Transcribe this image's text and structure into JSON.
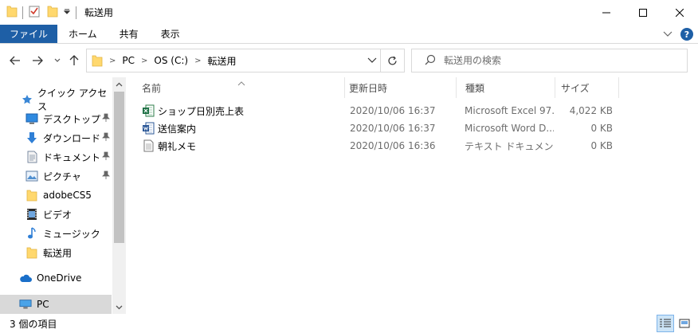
{
  "window": {
    "title": "転送用"
  },
  "ribbon": {
    "tabs": [
      {
        "label": "ファイル"
      },
      {
        "label": "ホーム"
      },
      {
        "label": "共有"
      },
      {
        "label": "表示"
      }
    ],
    "help_label": "?"
  },
  "address": {
    "crumbs": [
      "PC",
      "OS (C:)",
      "転送用"
    ]
  },
  "search": {
    "placeholder": "転送用の検索"
  },
  "nav": {
    "items": [
      {
        "label": "クイック アクセス",
        "icon": "star-icon"
      },
      {
        "label": "デスクトップ",
        "icon": "desktop-icon",
        "pinned": true
      },
      {
        "label": "ダウンロード",
        "icon": "download-icon",
        "pinned": true
      },
      {
        "label": "ドキュメント",
        "icon": "document-icon",
        "pinned": true
      },
      {
        "label": "ピクチャ",
        "icon": "picture-icon",
        "pinned": true
      },
      {
        "label": "adobeCS5",
        "icon": "folder-icon"
      },
      {
        "label": "ビデオ",
        "icon": "video-icon"
      },
      {
        "label": "ミュージック",
        "icon": "music-icon"
      },
      {
        "label": "転送用",
        "icon": "folder-icon"
      },
      {
        "label": "OneDrive",
        "icon": "cloud-icon"
      },
      {
        "label": "PC",
        "icon": "pc-icon",
        "selected": true
      }
    ]
  },
  "columns": {
    "name": "名前",
    "date": "更新日時",
    "type": "種類",
    "size": "サイズ"
  },
  "files": [
    {
      "name": "ショップ日別売上表",
      "date": "2020/10/06 16:37",
      "type": "Microsoft Excel 97...",
      "size": "4,022 KB",
      "icon": "excel-icon"
    },
    {
      "name": "送信案内",
      "date": "2020/10/06 16:37",
      "type": "Microsoft Word D...",
      "size": "0 KB",
      "icon": "word-icon"
    },
    {
      "name": "朝礼メモ",
      "date": "2020/10/06 16:36",
      "type": "テキスト ドキュメント",
      "size": "0 KB",
      "icon": "text-file-icon"
    }
  ],
  "status": {
    "item_count": "3 個の項目"
  },
  "colors": {
    "accent": "#1e5fa6",
    "folder": "#ffd86e",
    "selected": "#d9d9d9"
  }
}
